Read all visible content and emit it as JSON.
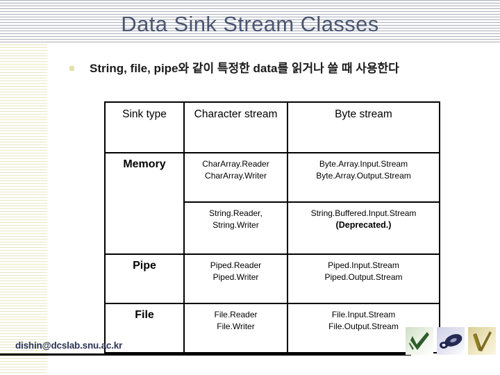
{
  "slide": {
    "title": "Data Sink Stream Classes",
    "bullet": "String, file, pipe와 같이 특정한 data를 읽거나 쓸 때 사용한다",
    "title_color": "#4a5570",
    "bullet_marker_color": "#e4e2a8"
  },
  "table": {
    "headers": [
      "Sink type",
      "Character stream",
      "Byte stream"
    ],
    "rows": [
      {
        "sink": "Memory",
        "character": [
          "CharArray.Reader",
          "CharArray.Writer"
        ],
        "byte": [
          "Byte.Array.Input.Stream",
          "Byte.Array.Output.Stream"
        ]
      },
      {
        "sink": "",
        "character": [
          "String.Reader,",
          "String.Writer"
        ],
        "byte": [
          "String.Buffered.Input.Stream",
          "(Deprecated.)"
        ]
      },
      {
        "sink": "Pipe",
        "character": [
          "Piped.Reader",
          "Piped.Writer"
        ],
        "byte": [
          "Piped.Input.Stream",
          "Piped.Output.Stream"
        ]
      },
      {
        "sink": "File",
        "character": [
          "File.Reader",
          "File.Writer"
        ],
        "byte": [
          "File.Input.Stream",
          "File.Output.Stream"
        ]
      }
    ]
  },
  "footer": {
    "email": "dishin@dcslab.snu.ac.kr"
  },
  "thumbnails": [
    {
      "name": "green-checkmark-thumbnail",
      "color": "#2e5c2a"
    },
    {
      "name": "dark-ellipse-thumbnail",
      "color": "#262a52"
    },
    {
      "name": "gold-checkmark-thumbnail",
      "color": "#7d6c22"
    }
  ]
}
